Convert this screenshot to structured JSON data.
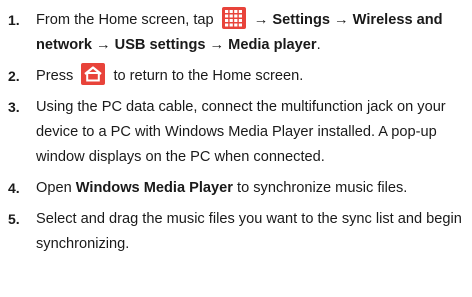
{
  "steps": [
    {
      "num": "1.",
      "t1": "From the Home screen, tap",
      "p1": "→ Settings → Wireless and network → USB settings → Media player",
      "t2": "."
    },
    {
      "num": "2.",
      "t1": "Press",
      "t2": "to return to the Home screen."
    },
    {
      "num": "3.",
      "t1": "Using the PC data cable, connect the multifunction jack on your device to a PC with Windows Media Player installed. A pop-up window displays on the PC when connected."
    },
    {
      "num": "4.",
      "t1": "Open",
      "b1": "Windows Media Player",
      "t2": "to synchronize music files."
    },
    {
      "num": "5.",
      "t1": "Select and drag the music files you want to the sync list and begin synchronizing."
    }
  ],
  "icons": {
    "menu_grid": "apps-grid-icon",
    "home": "home-icon",
    "accent": "#e8433a"
  }
}
